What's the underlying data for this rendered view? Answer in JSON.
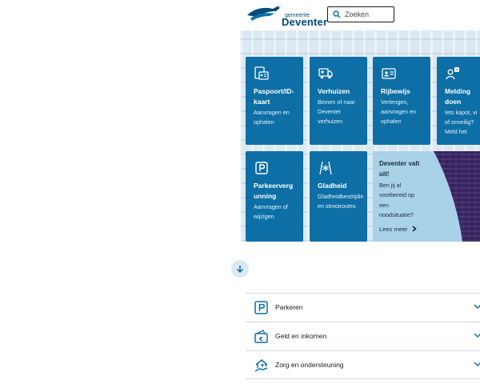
{
  "brand": {
    "line1": "gemeente",
    "line2": "Deventer",
    "primary_color": "#0d6fa6",
    "dark_color": "#004b7a"
  },
  "search": {
    "placeholder": "Zoeken"
  },
  "tiles": [
    {
      "title": "Paspoort/ID-kaart",
      "title_lines": [
        "Paspoort/ID-",
        "kaart"
      ],
      "desc_lines": [
        "Aanvragen en",
        "ophalen"
      ],
      "icon": "id-card-icon"
    },
    {
      "title": "Verhuizen",
      "title_lines": [
        "Verhuizen"
      ],
      "desc_lines": [
        "Binnen of naar",
        "Deventer",
        "verhuizen"
      ],
      "icon": "moving-truck-icon"
    },
    {
      "title": "Rijbewijs",
      "title_lines": [
        "Rijbewijs"
      ],
      "desc_lines": [
        "Verlengen,",
        "aanvragen en",
        "ophalen"
      ],
      "icon": "drivers-license-icon"
    },
    {
      "title": "Melding doen",
      "title_lines": [
        "Melding",
        "doen"
      ],
      "desc_lines": [
        "Iets kapot, vi",
        "of onveilig?",
        "Meld het"
      ],
      "icon": "report-person-icon"
    },
    {
      "title": "Parkeervergunning",
      "title_lines": [
        "Parkeerverg",
        "unning"
      ],
      "desc_lines": [
        "Aanvragen of",
        "wijzigen"
      ],
      "icon": "parking-icon"
    },
    {
      "title": "Gladheid",
      "title_lines": [
        "Gladheid"
      ],
      "desc_lines": [
        "Gladheidbestrijdin",
        "en strooiroutes"
      ],
      "icon": "snow-road-icon"
    }
  ],
  "promo": {
    "title_lines": [
      "Deventer valt",
      "uit!"
    ],
    "desc_lines": [
      "Ben jij al",
      "voorbereid op",
      "een",
      "noodsituatie?"
    ],
    "link": "Lees meer"
  },
  "accordion": [
    {
      "label": "Parkeren",
      "icon": "parking-icon"
    },
    {
      "label": "Geld en inkomen",
      "icon": "wallet-euro-icon"
    },
    {
      "label": "Zorg en ondersteuning",
      "icon": "care-home-icon"
    }
  ]
}
